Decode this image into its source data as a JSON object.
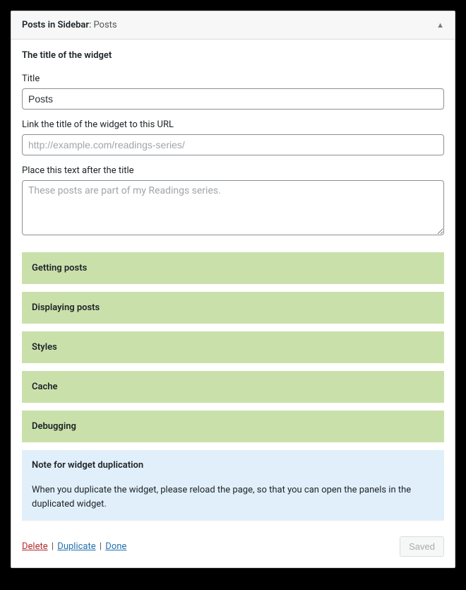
{
  "header": {
    "widget_name": "Posts in Sidebar",
    "separator": ": ",
    "instance_title": "Posts"
  },
  "title_section": {
    "heading": "The title of the widget",
    "title_label": "Title",
    "title_value": "Posts",
    "link_label": "Link the title of the widget to this URL",
    "link_placeholder": "http://example.com/readings-series/",
    "link_value": "",
    "intro_label": "Place this text after the title",
    "intro_placeholder": "These posts are part of my Readings series.",
    "intro_value": ""
  },
  "accordion": {
    "items": [
      {
        "label": "Getting posts"
      },
      {
        "label": "Displaying posts"
      },
      {
        "label": "Styles"
      },
      {
        "label": "Cache"
      },
      {
        "label": "Debugging"
      }
    ]
  },
  "note": {
    "title": "Note for widget duplication",
    "text": "When you duplicate the widget, please reload the page, so that you can open the panels in the duplicated widget."
  },
  "footer": {
    "delete": "Delete",
    "duplicate": "Duplicate",
    "done": "Done",
    "separator": "|",
    "saved": "Saved"
  }
}
